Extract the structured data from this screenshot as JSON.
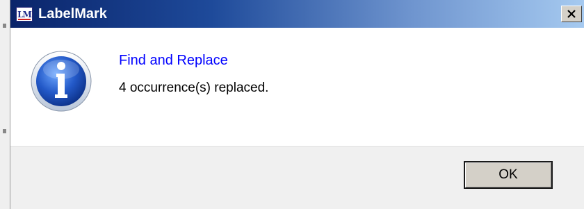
{
  "window": {
    "title": "LabelMark",
    "app_icon_text": "LM",
    "close_glyph": "X"
  },
  "message": {
    "heading": "Find and Replace",
    "body": "4 occurrence(s) replaced.",
    "icon": "info-icon"
  },
  "buttons": {
    "ok_label": "OK"
  },
  "colors": {
    "heading": "#0000ff",
    "titlebar_start": "#0a246a",
    "titlebar_end": "#a6caf0"
  }
}
